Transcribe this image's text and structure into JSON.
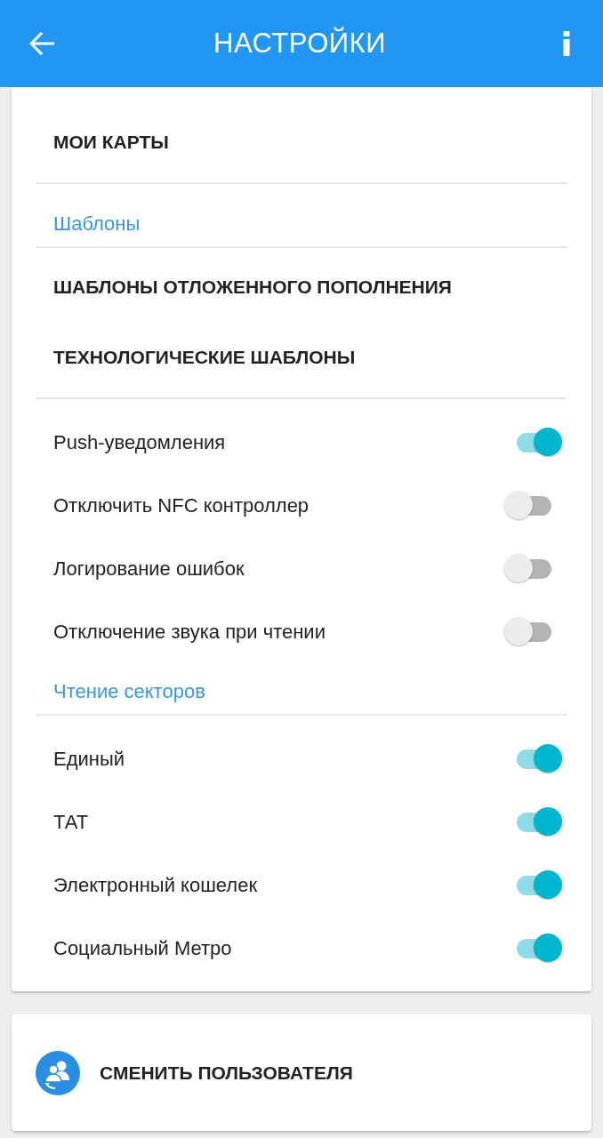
{
  "app_bar": {
    "title": "НАСТРОЙКИ"
  },
  "groups": [
    {
      "kind": "links",
      "items": [
        {
          "label": "МОИ КАРТЫ"
        }
      ]
    },
    {
      "kind": "links",
      "header": "Шаблоны",
      "items": [
        {
          "label": "ШАБЛОНЫ ОТЛОЖЕННОГО ПОПОЛНЕНИЯ"
        },
        {
          "label": "ТЕХНОЛОГИЧЕСКИЕ ШАБЛОНЫ"
        }
      ]
    },
    {
      "kind": "toggles",
      "items": [
        {
          "label": "Push-уведомления",
          "on": true
        },
        {
          "label": "Отключить NFC контроллер",
          "on": false
        },
        {
          "label": "Логирование ошибок",
          "on": false
        },
        {
          "label": "Отключение звука при чтении",
          "on": false
        }
      ]
    },
    {
      "kind": "toggles",
      "header": "Чтение секторов",
      "items": [
        {
          "label": "Единый",
          "on": true
        },
        {
          "label": "ТАТ",
          "on": true
        },
        {
          "label": "Электронный кошелек",
          "on": true
        },
        {
          "label": "Социальный Метро",
          "on": true
        }
      ]
    }
  ],
  "account_button": {
    "label": "СМЕНИТЬ ПОЛЬЗОВАТЕЛЯ"
  }
}
